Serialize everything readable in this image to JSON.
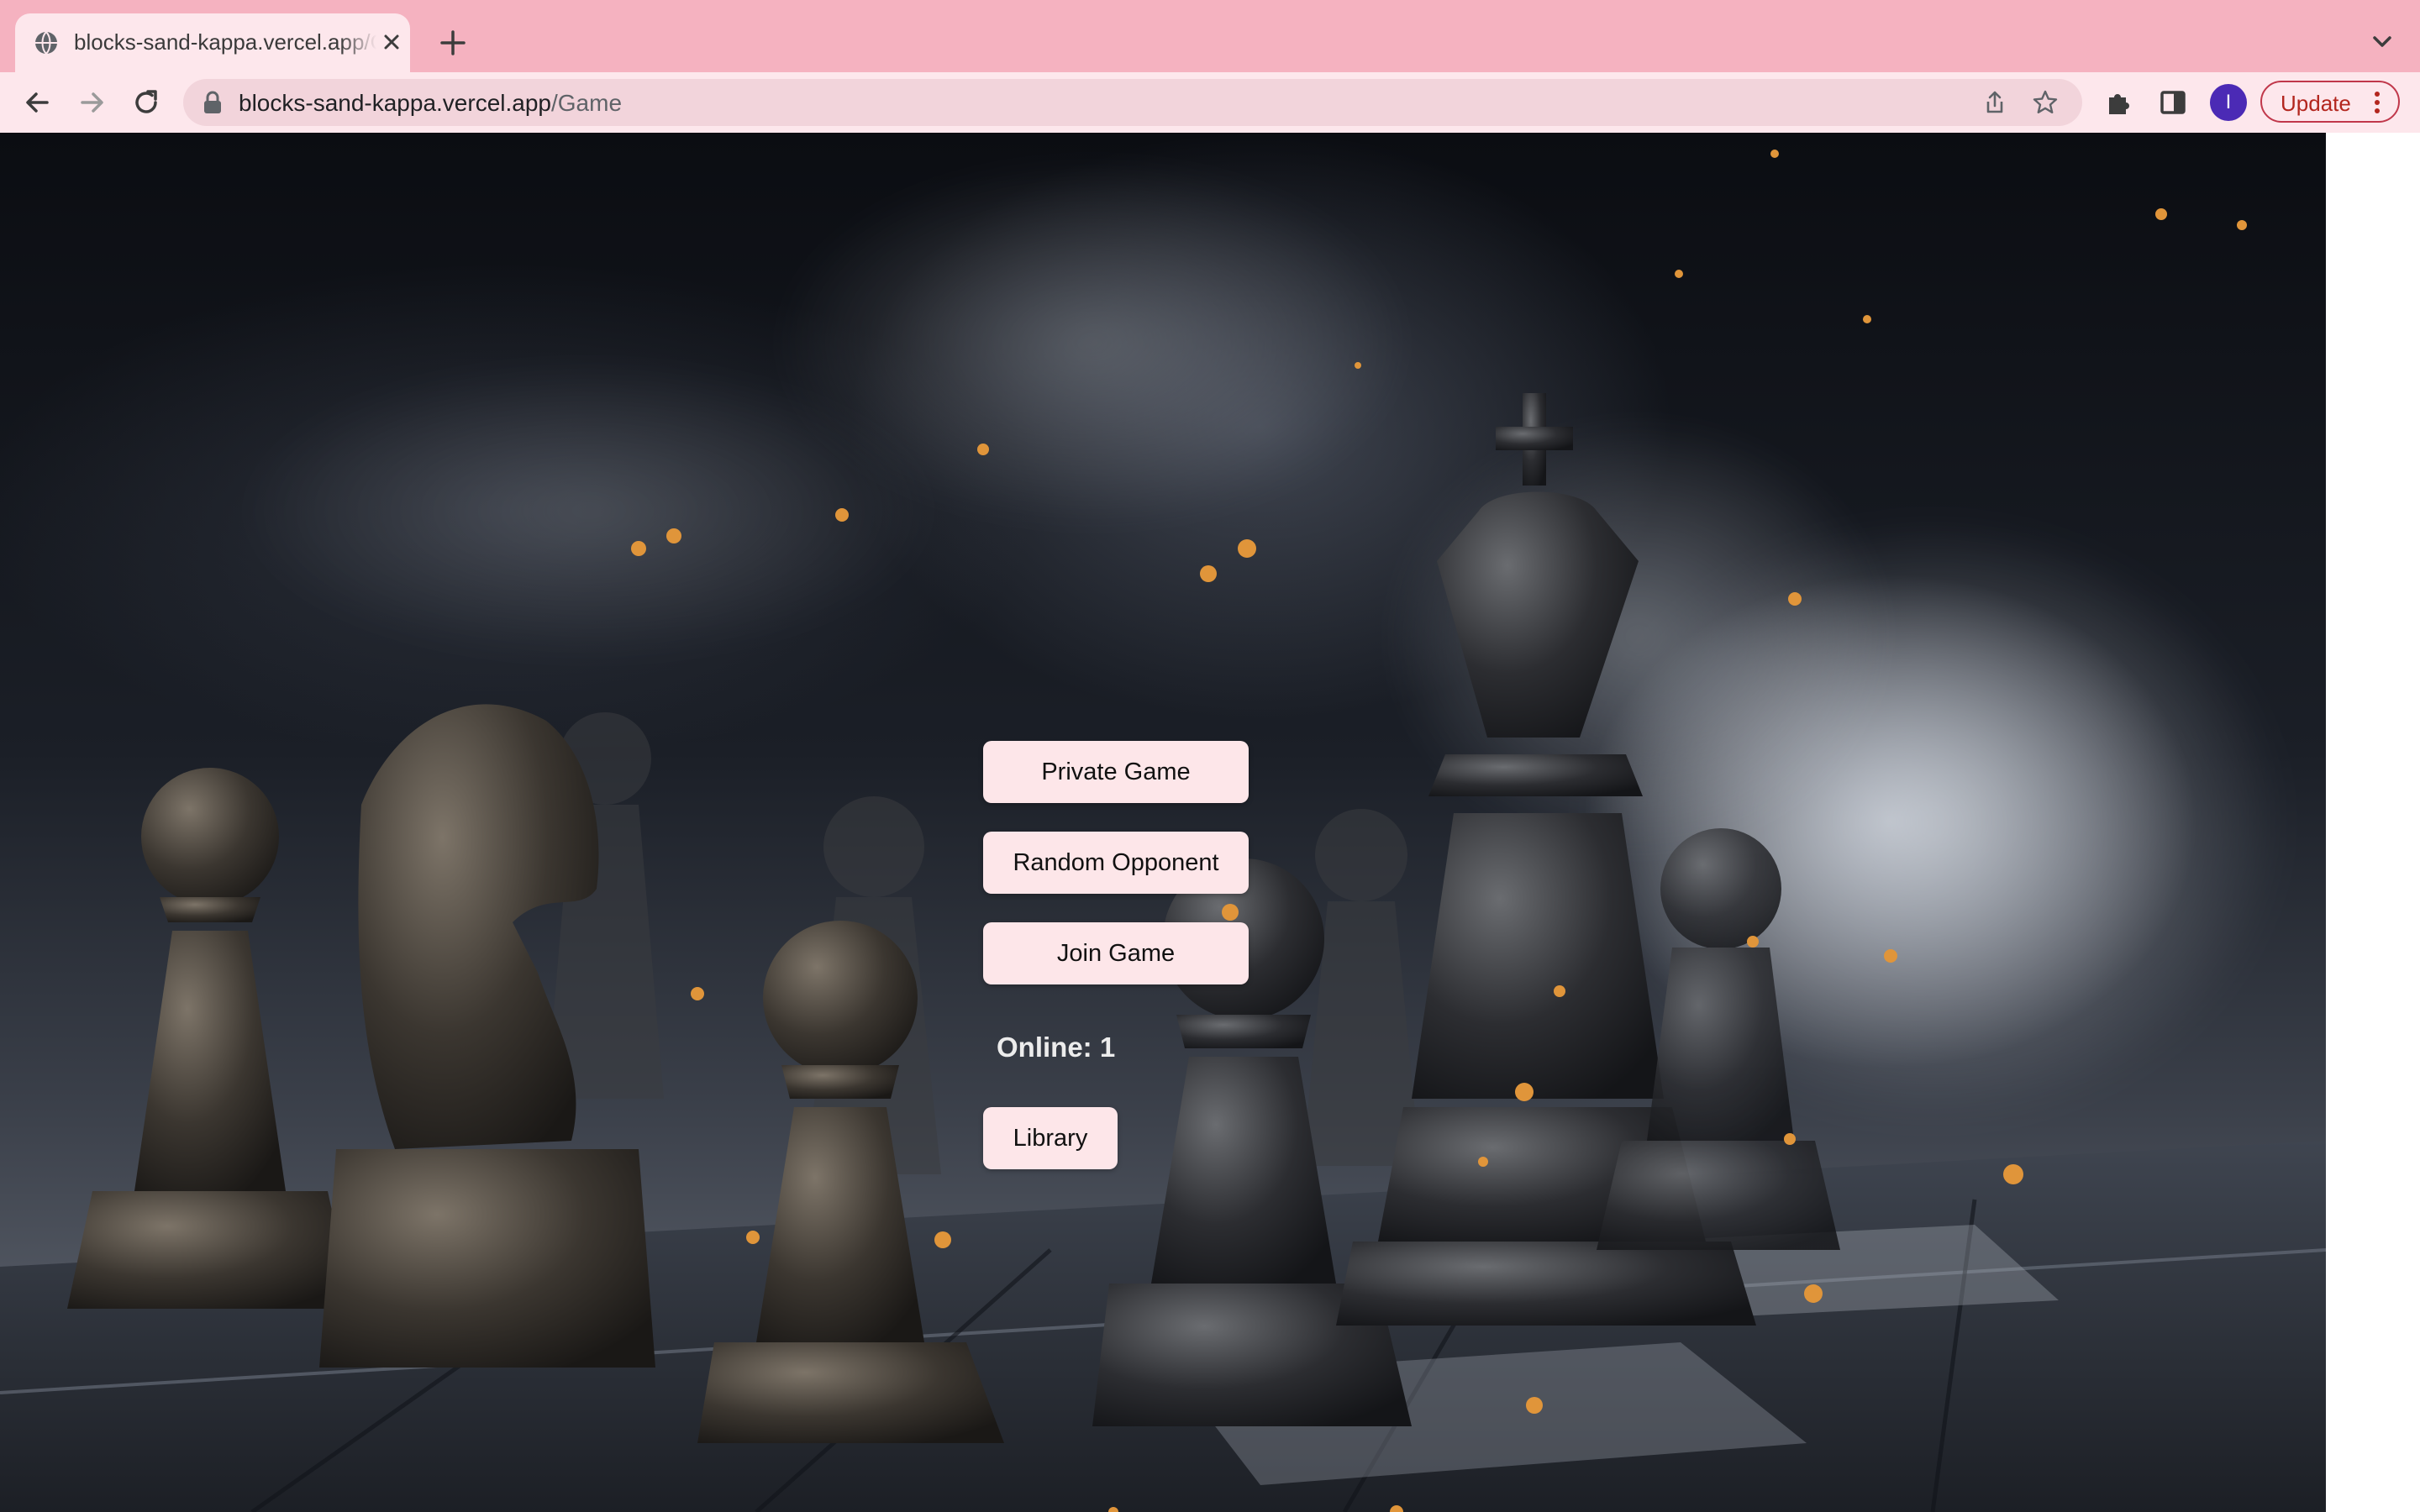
{
  "browser": {
    "tab": {
      "title": "blocks-sand-kappa.vercel.app/Game",
      "favicon": "globe-icon"
    },
    "address": {
      "host": "blocks-sand-kappa.vercel.app",
      "path": "/Game"
    },
    "profile_initial": "I",
    "update_label": "Update",
    "colors": {
      "tab_strip": "#f5b2c0",
      "toolbar": "#fde7ec",
      "omnibox": "#f2d4db",
      "update_accent": "#b3261e"
    }
  },
  "menu": {
    "private_game": "Private Game",
    "random_opponent": "Random Opponent",
    "join_game": "Join Game",
    "online": "Online: 1",
    "library": "Library",
    "button_color": "#fde6e9"
  },
  "background": {
    "subject": "smoky black chess pieces on a chessboard"
  }
}
